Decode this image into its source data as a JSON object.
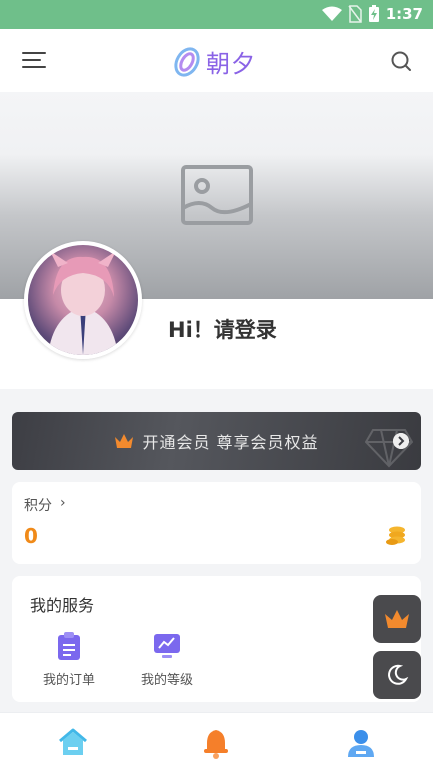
{
  "status_bar": {
    "time": "1:37",
    "icons": [
      "wifi-icon",
      "no-sim-icon",
      "battery-charging-icon"
    ]
  },
  "header": {
    "brand_text": "朝夕",
    "menu_icon": "menu-icon",
    "search_icon": "search-icon"
  },
  "banner": {
    "placeholder_icon": "image-placeholder-icon"
  },
  "profile": {
    "greeting": "Hi！请登录"
  },
  "vip": {
    "text": "开通会员 尊享会员权益",
    "icon": "crown-icon",
    "arrow_icon": "chevron-right-circle-icon"
  },
  "points": {
    "label": "积分",
    "chevron": "›",
    "value": "0",
    "icon": "coins-icon"
  },
  "services": {
    "title": "我的服务",
    "items": [
      {
        "label": "我的订单",
        "icon": "clipboard-icon"
      },
      {
        "label": "我的等级",
        "icon": "chart-monitor-icon"
      }
    ]
  },
  "floating": {
    "buttons": [
      "crown-icon",
      "moon-icon"
    ]
  },
  "tab_bar": {
    "tabs": [
      "home-icon",
      "bell-icon",
      "user-icon"
    ]
  },
  "colors": {
    "status_bar": "#6fbf8a",
    "accent_orange": "#f08a19",
    "brand_purple": "#8a63e6",
    "service_icon": "#7b68ee",
    "tab_home": "#42b8e8",
    "tab_bell": "#f57f2a",
    "tab_user": "#3b8fea"
  }
}
